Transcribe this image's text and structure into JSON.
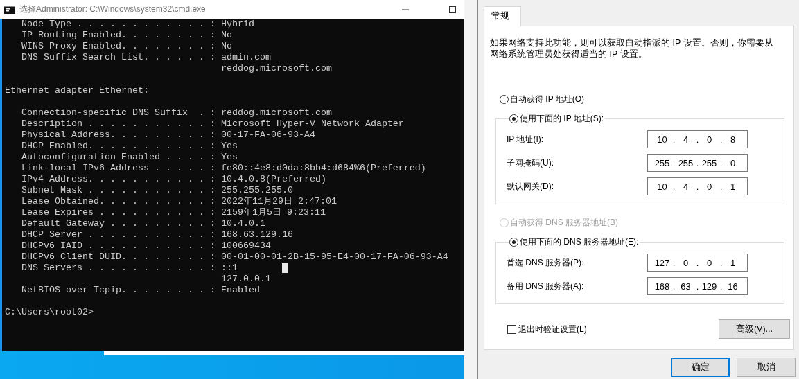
{
  "cmd_window": {
    "title": "选择Administrator: C:\\Windows\\system32\\cmd.exe",
    "console": {
      "blocks": [
        [
          {
            "text": "   Node Type . . . . . . . . . . . . : Hybrid"
          },
          {
            "text": "   IP Routing Enabled. . . . . . . . : No"
          },
          {
            "text": "   WINS Proxy Enabled. . . . . . . . : No"
          },
          {
            "text": "   DNS Suffix Search List. . . . . . : admin.com"
          },
          {
            "text": "                                       reddog.microsoft.com"
          }
        ],
        [
          {
            "text": "Ethernet adapter Ethernet:"
          }
        ],
        [
          {
            "text": "   Connection-specific DNS Suffix  . : reddog.microsoft.com"
          },
          {
            "text": "   Description . . . . . . . . . . . : Microsoft Hyper-V Network Adapter"
          },
          {
            "text": "   Physical Address. . . . . . . . . : 00-17-FA-06-93-A4"
          },
          {
            "text": "   DHCP Enabled. . . . . . . . . . . : Yes"
          },
          {
            "text": "   Autoconfiguration Enabled . . . . : Yes"
          },
          {
            "text": "   Link-local IPv6 Address . . . . . : fe80::4e8:d0da:8bb4:d684%6(Preferred)"
          },
          {
            "text": "   IPv4 Address. . . . . . . . . . . : 10.4.0.8(Preferred)"
          },
          {
            "text": "   Subnet Mask . . . . . . . . . . . : 255.255.255.0"
          },
          {
            "text": "   Lease Obtained. . . . . . . . . . : 2022年11月29日 2:47:01"
          },
          {
            "text": "   Lease Expires . . . . . . . . . . : 2159年1月5日 9:23:11"
          },
          {
            "text": "   Default Gateway . . . . . . . . . : 10.4.0.1"
          },
          {
            "text": "   DHCP Server . . . . . . . . . . . : 168.63.129.16"
          },
          {
            "text": "   DHCPv6 IAID . . . . . . . . . . . : 100669434"
          },
          {
            "text": "   DHCPv6 Client DUID. . . . . . . . : 00-01-00-01-2B-15-95-E4-00-17-FA-06-93-A4"
          },
          {
            "text": "   DNS Servers . . . . . . . . . . . : ::1",
            "cursor": true
          },
          {
            "text": "                                       127.0.0.1"
          },
          {
            "text": "   NetBIOS over Tcpip. . . . . . . . : Enabled"
          }
        ],
        [
          {
            "text": "C:\\Users\\root02>"
          }
        ]
      ]
    }
  },
  "dialog": {
    "tabs": [
      {
        "label": "常规",
        "selected": true
      }
    ],
    "description": "如果网络支持此功能，则可以获取自动指派的 IP 设置。否则，你需要从网络系统管理员处获得适当的 IP 设置。",
    "sections": [
      {
        "options": [
          {
            "label": "自动获得 IP 地址(O)",
            "selected": false,
            "disabled": false
          },
          {
            "label": "使用下面的 IP 地址(S):",
            "selected": true,
            "disabled": false
          }
        ],
        "fields": [
          {
            "label": "IP 地址(I):",
            "octets": [
              "10",
              "4",
              "0",
              "8"
            ]
          },
          {
            "label": "子网掩码(U):",
            "octets": [
              "255",
              "255",
              "255",
              "0"
            ]
          },
          {
            "label": "默认网关(D):",
            "octets": [
              "10",
              "4",
              "0",
              "1"
            ]
          }
        ]
      },
      {
        "options": [
          {
            "label": "自动获得 DNS 服务器地址(B)",
            "selected": false,
            "disabled": true
          },
          {
            "label": "使用下面的 DNS 服务器地址(E):",
            "selected": true,
            "disabled": false
          }
        ],
        "fields": [
          {
            "label": "首选 DNS 服务器(P):",
            "octets": [
              "127",
              "0",
              "0",
              "1"
            ]
          },
          {
            "label": "备用 DNS 服务器(A):",
            "octets": [
              "168",
              "63",
              "129",
              "16"
            ]
          }
        ]
      }
    ],
    "separator": ".",
    "validate_checkbox": {
      "label": "退出时验证设置(L)",
      "checked": false
    },
    "advanced_button": "高级(V)...",
    "buttons": [
      {
        "label": "确定",
        "default": true
      },
      {
        "label": "取消",
        "default": false
      }
    ]
  }
}
